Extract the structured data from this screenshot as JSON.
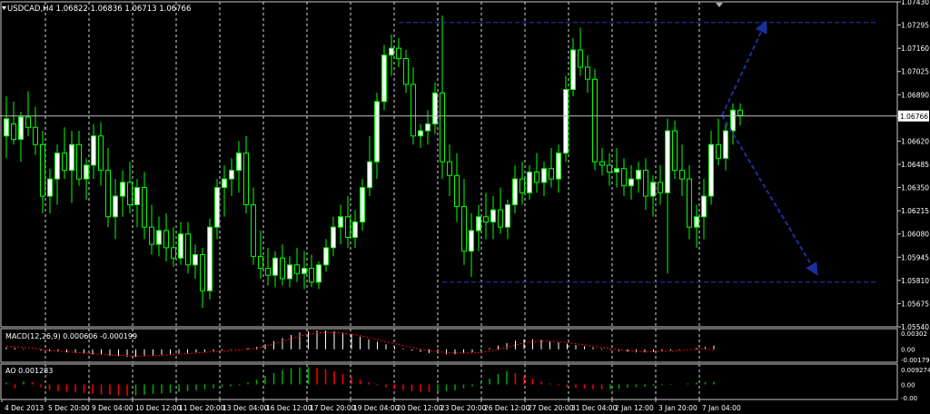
{
  "colors": {
    "background": "#000000",
    "bull": "#00ff00",
    "bear": "#00ff00",
    "bull_body": "#ffffff",
    "bear_body": "#000000",
    "grid": "#ffffff",
    "axis_text": "#ffffff",
    "trendlines": "#1b2f9c",
    "macd_hist": "#ffffff",
    "macd_signal": "#ff0000",
    "ao_up": "#00aa00",
    "ao_down": "#ff0000"
  },
  "price_panel": {
    "label": "USDCAD,H4  1.06822 1.06836 1.06713 1.06766",
    "current_price": "1.06766",
    "y_ticks": [
      "1.07430",
      "1.07295",
      "1.07160",
      "1.07025",
      "1.06890",
      "1.06755",
      "1.06620",
      "1.06485",
      "1.06350",
      "1.06215",
      "1.06080",
      "1.05945",
      "1.05810",
      "1.05675",
      "1.05540"
    ]
  },
  "macd_panel": {
    "label": "MACD(12,26,9) 0.000606 -0.000199",
    "y_ticks": [
      "0.00302",
      "0.00",
      "-0.00179"
    ]
  },
  "ao_panel": {
    "label": "AO 0.001283",
    "y_ticks": [
      "0.009274",
      "0.00",
      "-0.00"
    ]
  },
  "x_axis": {
    "ticks": [
      "4 Dec 2013",
      "5 Dec 20:00",
      "9 Dec 04:00",
      "10 Dec 12:00",
      "11 Dec 20:00",
      "13 Dec 04:00",
      "16 Dec 12:00",
      "17 Dec 20:00",
      "19 Dec 04:00",
      "20 Dec 12:00",
      "23 Dec 20:00",
      "26 Dec 12:00",
      "27 Dec 20:00",
      "31 Dec 04:00",
      "2 Jan 12:00",
      "3 Jan 20:00",
      "7 Jan 04:00"
    ]
  },
  "chart_data": {
    "type": "candlestick",
    "symbol": "USDCAD",
    "timeframe": "H4",
    "ylim": [
      1.0554,
      1.0743
    ],
    "candles": [
      [
        1.0665,
        1.0688,
        1.0652,
        1.0675
      ],
      [
        1.0672,
        1.0685,
        1.066,
        1.0663
      ],
      [
        1.0663,
        1.0679,
        1.065,
        1.0676
      ],
      [
        1.0676,
        1.0691,
        1.0665,
        1.067
      ],
      [
        1.067,
        1.0682,
        1.0654,
        1.066
      ],
      [
        1.066,
        1.0668,
        1.062,
        1.063
      ],
      [
        1.063,
        1.0646,
        1.062,
        1.064
      ],
      [
        1.064,
        1.066,
        1.0625,
        1.0655
      ],
      [
        1.0655,
        1.067,
        1.064,
        1.0645
      ],
      [
        1.0645,
        1.0668,
        1.0626,
        1.066
      ],
      [
        1.066,
        1.0668,
        1.0636,
        1.064
      ],
      [
        1.064,
        1.0652,
        1.0628,
        1.0648
      ],
      [
        1.0648,
        1.0672,
        1.064,
        1.0665
      ],
      [
        1.0665,
        1.0673,
        1.0636,
        1.0645
      ],
      [
        1.0645,
        1.0658,
        1.0612,
        1.0618
      ],
      [
        1.0618,
        1.064,
        1.0605,
        1.063
      ],
      [
        1.063,
        1.0645,
        1.0618,
        1.0638
      ],
      [
        1.0638,
        1.065,
        1.062,
        1.0625
      ],
      [
        1.0625,
        1.064,
        1.0612,
        1.0635
      ],
      [
        1.0635,
        1.0644,
        1.0605,
        1.0612
      ],
      [
        1.0612,
        1.0625,
        1.0596,
        1.0602
      ],
      [
        1.0602,
        1.0618,
        1.0595,
        1.061
      ],
      [
        1.061,
        1.062,
        1.0592,
        1.06
      ],
      [
        1.06,
        1.0612,
        1.0589,
        1.0594
      ],
      [
        1.0594,
        1.0615,
        1.059,
        1.0608
      ],
      [
        1.0608,
        1.0615,
        1.0585,
        1.059
      ],
      [
        1.059,
        1.0602,
        1.0582,
        1.0596
      ],
      [
        1.0596,
        1.06,
        1.0565,
        1.0575
      ],
      [
        1.0575,
        1.0617,
        1.057,
        1.0612
      ],
      [
        1.0612,
        1.064,
        1.0605,
        1.0635
      ],
      [
        1.0635,
        1.0648,
        1.0618,
        1.064
      ],
      [
        1.064,
        1.0652,
        1.063,
        1.0645
      ],
      [
        1.0645,
        1.0662,
        1.0632,
        1.0655
      ],
      [
        1.0655,
        1.0665,
        1.062,
        1.0625
      ],
      [
        1.0625,
        1.0635,
        1.059,
        1.0595
      ],
      [
        1.0595,
        1.061,
        1.0582,
        1.0588
      ],
      [
        1.0588,
        1.06,
        1.0578,
        1.0584
      ],
      [
        1.0584,
        1.0598,
        1.0577,
        1.0594
      ],
      [
        1.0594,
        1.0602,
        1.0578,
        1.0582
      ],
      [
        1.0582,
        1.0595,
        1.0577,
        1.059
      ],
      [
        1.059,
        1.06,
        1.058,
        1.0585
      ],
      [
        1.0585,
        1.0598,
        1.0576,
        1.0588
      ],
      [
        1.0588,
        1.0596,
        1.0577,
        1.058
      ],
      [
        1.058,
        1.0592,
        1.0576,
        1.059
      ],
      [
        1.059,
        1.0605,
        1.0586,
        1.06
      ],
      [
        1.06,
        1.0618,
        1.0595,
        1.0612
      ],
      [
        1.0612,
        1.0625,
        1.0602,
        1.0618
      ],
      [
        1.0618,
        1.063,
        1.06,
        1.0606
      ],
      [
        1.0606,
        1.0622,
        1.06,
        1.0615
      ],
      [
        1.0615,
        1.064,
        1.061,
        1.0635
      ],
      [
        1.0635,
        1.0665,
        1.063,
        1.065
      ],
      [
        1.065,
        1.069,
        1.064,
        1.0685
      ],
      [
        1.0685,
        1.0718,
        1.068,
        1.0712
      ],
      [
        1.0712,
        1.0724,
        1.07,
        1.0716
      ],
      [
        1.0716,
        1.0722,
        1.0705,
        1.071
      ],
      [
        1.071,
        1.0715,
        1.069,
        1.0695
      ],
      [
        1.0695,
        1.0705,
        1.066,
        1.0665
      ],
      [
        1.0665,
        1.0672,
        1.0658,
        1.0668
      ],
      [
        1.0668,
        1.068,
        1.066,
        1.0672
      ],
      [
        1.0672,
        1.0696,
        1.0666,
        1.069
      ],
      [
        1.069,
        1.0735,
        1.064,
        1.065
      ],
      [
        1.065,
        1.066,
        1.063,
        1.0642
      ],
      [
        1.0642,
        1.0655,
        1.0615,
        1.0624
      ],
      [
        1.0624,
        1.064,
        1.059,
        1.0598
      ],
      [
        1.0598,
        1.062,
        1.0583,
        1.061
      ],
      [
        1.061,
        1.0625,
        1.0598,
        1.0618
      ],
      [
        1.0618,
        1.0632,
        1.0605,
        1.0615
      ],
      [
        1.0615,
        1.063,
        1.0605,
        1.0622
      ],
      [
        1.0622,
        1.0635,
        1.0608,
        1.0612
      ],
      [
        1.0612,
        1.0628,
        1.0605,
        1.0625
      ],
      [
        1.0625,
        1.0648,
        1.062,
        1.064
      ],
      [
        1.064,
        1.065,
        1.0625,
        1.0632
      ],
      [
        1.0632,
        1.0648,
        1.0628,
        1.0644
      ],
      [
        1.0644,
        1.0655,
        1.0632,
        1.0638
      ],
      [
        1.0638,
        1.065,
        1.063,
        1.0646
      ],
      [
        1.0646,
        1.0658,
        1.0635,
        1.064
      ],
      [
        1.064,
        1.066,
        1.0632,
        1.0655
      ],
      [
        1.0655,
        1.07,
        1.065,
        1.0692
      ],
      [
        1.0692,
        1.0722,
        1.0688,
        1.0715
      ],
      [
        1.0715,
        1.0728,
        1.07,
        1.0705
      ],
      [
        1.0705,
        1.0712,
        1.069,
        1.0698
      ],
      [
        1.0698,
        1.0704,
        1.0645,
        1.065
      ],
      [
        1.065,
        1.0658,
        1.0642,
        1.0648
      ],
      [
        1.0648,
        1.0655,
        1.0636,
        1.0644
      ],
      [
        1.0644,
        1.0658,
        1.0635,
        1.0646
      ],
      [
        1.0646,
        1.0652,
        1.063,
        1.0636
      ],
      [
        1.0636,
        1.0648,
        1.0628,
        1.064
      ],
      [
        1.064,
        1.065,
        1.0632,
        1.0645
      ],
      [
        1.0645,
        1.0652,
        1.0622,
        1.063
      ],
      [
        1.063,
        1.0642,
        1.0618,
        1.0638
      ],
      [
        1.0638,
        1.0648,
        1.0625,
        1.0632
      ],
      [
        1.0632,
        1.0675,
        1.0585,
        1.0668
      ],
      [
        1.0668,
        1.0674,
        1.064,
        1.0645
      ],
      [
        1.0645,
        1.066,
        1.063,
        1.064
      ],
      [
        1.064,
        1.0648,
        1.0605,
        1.0612
      ],
      [
        1.0612,
        1.0625,
        1.06,
        1.0618
      ],
      [
        1.0618,
        1.064,
        1.0605,
        1.063
      ],
      [
        1.063,
        1.0668,
        1.0625,
        1.066
      ],
      [
        1.066,
        1.0675,
        1.0648,
        1.0652
      ],
      [
        1.0652,
        1.0672,
        1.0645,
        1.0668
      ],
      [
        1.0668,
        1.0684,
        1.066,
        1.068
      ],
      [
        1.068,
        1.0684,
        1.0671,
        1.0677
      ]
    ],
    "macd": {
      "histogram": [
        0.0003,
        0.0002,
        0.0001,
        0.0,
        -0.0002,
        -0.0003,
        -0.0004,
        -0.0005,
        -0.0006,
        -0.0007,
        -0.0008,
        -0.0009,
        -0.001,
        -0.0011,
        -0.0012,
        -0.0012,
        -0.0011,
        -0.001,
        -0.0009,
        -0.0008,
        -0.0007,
        -0.0006,
        -0.0005,
        -0.0004,
        -0.0003,
        -0.0002,
        -0.0001,
        0.0,
        0.0002,
        0.0004,
        0.0008,
        0.0013,
        0.0018,
        0.0023,
        0.0027,
        0.0029,
        0.003,
        0.003,
        0.0029,
        0.0027,
        0.0024,
        0.002,
        0.0016,
        0.0012,
        0.0008,
        0.0004,
        0.0001,
        -0.0002,
        -0.0004,
        -0.0006,
        -0.0007,
        -0.0008,
        -0.0008,
        -0.0007,
        -0.0005,
        -0.0002,
        0.0002,
        0.0006,
        0.001,
        0.0014,
        0.0016,
        0.0016,
        0.0015,
        0.0013,
        0.0011,
        0.0009,
        0.0007,
        0.0005,
        0.0003,
        0.0001,
        -0.0001,
        -0.0003,
        -0.0004,
        -0.0005,
        -0.0005,
        -0.0004,
        -0.0003,
        -0.0002,
        -0.0001,
        0.0,
        0.0002,
        0.0004,
        0.0006
      ],
      "signal": [
        0.0005,
        0.0004,
        0.0003,
        0.0002,
        0.0,
        -0.0002,
        -0.0003,
        -0.0004,
        -0.0005,
        -0.0006,
        -0.0007,
        -0.0008,
        -0.0009,
        -0.001,
        -0.001,
        -0.0011,
        -0.0011,
        -0.001,
        -0.001,
        -0.0009,
        -0.0008,
        -0.0007,
        -0.0006,
        -0.0005,
        -0.0004,
        -0.0003,
        -0.0002,
        -0.0001,
        0.0,
        0.0002,
        0.0005,
        0.0009,
        0.0013,
        0.0017,
        0.0021,
        0.0024,
        0.0026,
        0.0027,
        0.0027,
        0.0026,
        0.0024,
        0.0022,
        0.0019,
        0.0016,
        0.0012,
        0.0009,
        0.0006,
        0.0003,
        0.0,
        -0.0002,
        -0.0004,
        -0.0005,
        -0.0006,
        -0.0006,
        -0.0006,
        -0.0005,
        -0.0003,
        0.0,
        0.0003,
        0.0007,
        0.001,
        0.0012,
        0.0013,
        0.0013,
        0.0012,
        0.0011,
        0.0009,
        0.0007,
        0.0005,
        0.0003,
        0.0001,
        -0.0001,
        -0.0002,
        -0.0003,
        -0.0004,
        -0.0004,
        -0.0003,
        -0.0003,
        -0.0002,
        -0.0001,
        0.0,
        0.0001,
        -0.0002
      ]
    },
    "ao": [
      0.001,
      -0.002,
      0.0015,
      0.0012,
      -0.0015,
      -0.003,
      -0.0035,
      -0.004,
      -0.0042,
      -0.0045,
      -0.005,
      -0.0052,
      -0.0055,
      -0.0058,
      -0.006,
      -0.0058,
      -0.0055,
      -0.005,
      -0.0048,
      -0.0045,
      -0.004,
      -0.0035,
      -0.003,
      -0.0025,
      -0.002,
      -0.0015,
      -0.001,
      -0.0005,
      0.001,
      0.0025,
      0.0045,
      0.006,
      0.0075,
      0.0085,
      0.009,
      0.0092,
      0.0088,
      0.008,
      0.007,
      0.0055,
      0.004,
      0.0025,
      0.001,
      -0.0005,
      -0.0015,
      -0.0025,
      -0.003,
      -0.0035,
      -0.0038,
      -0.004,
      -0.0038,
      -0.0035,
      -0.003,
      -0.002,
      -0.001,
      0.001,
      0.003,
      0.0055,
      0.007,
      0.006,
      0.0045,
      0.003,
      0.0015,
      0.0005,
      -0.0005,
      -0.0012,
      -0.0018,
      -0.0022,
      -0.0025,
      -0.0026,
      -0.0025,
      -0.0022,
      -0.0018,
      -0.0015,
      -0.0012,
      -0.0008,
      -0.0005,
      -0.0003,
      0.0,
      0.0005,
      0.001,
      0.0012,
      0.0013
    ],
    "resistance": 1.0731,
    "support": 1.058,
    "arrows": [
      {
        "from": [
          99,
          1.0677
        ],
        "to": [
          105,
          1.0731
        ]
      },
      {
        "from": [
          99,
          1.0677
        ],
        "to": [
          112,
          1.0585
        ]
      }
    ]
  }
}
